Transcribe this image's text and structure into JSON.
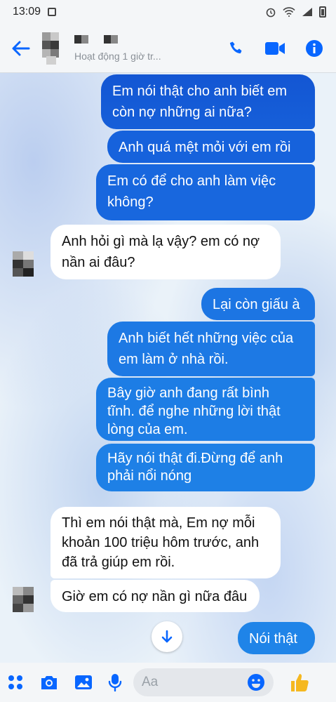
{
  "status_bar": {
    "time": "13:09"
  },
  "header": {
    "presence": "Hoạt động 1 giờ tr..."
  },
  "messages": [
    {
      "id": "m1",
      "from": "me",
      "lines": [
        "Em nói thật cho anh biết em",
        "còn nợ những ai nữa?"
      ]
    },
    {
      "id": "m2",
      "from": "me",
      "lines": [
        "Anh quá mệt mỏi với em rồi"
      ]
    },
    {
      "id": "m3",
      "from": "me",
      "lines": [
        "Em có để cho anh làm việc",
        "không?"
      ]
    },
    {
      "id": "m4",
      "from": "them",
      "lines": [
        "Anh hỏi gì mà lạ vậy? em có nợ",
        "nần ai đâu?"
      ]
    },
    {
      "id": "m5",
      "from": "me",
      "lines": [
        "Lại còn giấu à"
      ]
    },
    {
      "id": "m6",
      "from": "me",
      "lines": [
        "Anh biết hết những việc của",
        "em làm ở nhà rồi."
      ]
    },
    {
      "id": "m7",
      "from": "me",
      "lines": [
        "Bây giờ anh đang rất bình",
        "tĩnh. để nghe những lời thật",
        "lòng của em."
      ]
    },
    {
      "id": "m8",
      "from": "me",
      "lines": [
        "Hãy nói thật đi.Đừng để anh",
        "phải nổi nóng"
      ]
    },
    {
      "id": "m9",
      "from": "them",
      "lines": [
        "Thì em nói thật mà,  Em nợ mỗi",
        "khoản 100 triệu hôm trước, anh",
        "đã trả giúp em rồi."
      ]
    },
    {
      "id": "m10",
      "from": "them",
      "lines": [
        "Giờ em có nợ nần gì nữa đâu"
      ]
    },
    {
      "id": "m11",
      "from": "me",
      "lines": [
        "Nói thật"
      ]
    }
  ],
  "composer": {
    "placeholder": "Aa"
  },
  "colors": {
    "accent": "#0866ff",
    "bubble_top": "#1457d6",
    "bubble_bottom": "#1a7fe0",
    "like": "#f5b820"
  },
  "icons": [
    "back-arrow-icon",
    "phone-icon",
    "video-icon",
    "info-icon",
    "menu-grid-icon",
    "camera-icon",
    "gallery-icon",
    "microphone-icon",
    "emoji-icon",
    "thumbs-up-icon",
    "arrow-down-icon"
  ]
}
